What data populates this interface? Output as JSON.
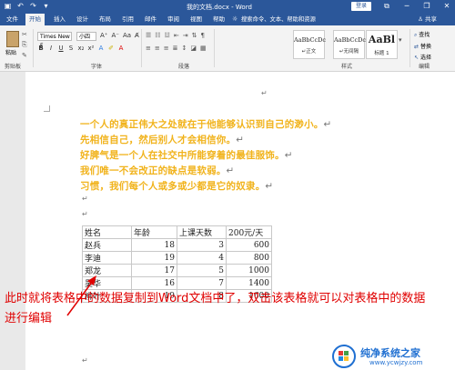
{
  "titlebar": {
    "doc_title": "我的文档.docx - Word",
    "login": "登录",
    "minimize": "─",
    "restore": "❐",
    "close": "✕"
  },
  "tabs": [
    "文件",
    "开始",
    "插入",
    "设计",
    "布局",
    "引用",
    "邮件",
    "审阅",
    "视图",
    "帮助"
  ],
  "active_tab": "开始",
  "tell_me": "搜索命令、文本、帮助和资源",
  "share": "共享",
  "ribbon": {
    "paste": "粘贴",
    "font_name": "Times New F",
    "font_size": "小四",
    "groups": {
      "clipboard": "剪贴板",
      "font": "字体",
      "paragraph": "段落",
      "styles": "样式",
      "edit": "编辑"
    },
    "styles": [
      {
        "sample": "AaBbCcDc",
        "name": "↵正文"
      },
      {
        "sample": "AaBbCcDc",
        "name": "↵无间隔"
      },
      {
        "sample": "AaBl",
        "name": "标题 1"
      }
    ],
    "edit_items": [
      "查找",
      "替换",
      "选择"
    ]
  },
  "document": {
    "lines": [
      "一个人的真正伟大之处就在于他能够认识到自己的渺小。",
      "先相信自己，然后别人才会相信你。",
      "好脾气是一个人在社交中所能穿着的最佳服饰。",
      "我们唯一不会改正的缺点是软弱。",
      "习惯，我们每个人或多或少都是它的奴隶。"
    ],
    "para_mark": "↵",
    "text_color": "#f1b31c",
    "table": {
      "headers": [
        "姓名",
        "年龄",
        "上课天数",
        "200元/天"
      ],
      "rows": [
        [
          "赵兵",
          "18",
          "3",
          "600"
        ],
        [
          "李迪",
          "19",
          "4",
          "800"
        ],
        [
          "郑龙",
          "17",
          "5",
          "1000"
        ],
        [
          "吴华",
          "16",
          "7",
          "1400"
        ],
        [
          "柳叶",
          "19",
          "8",
          "1600"
        ]
      ]
    }
  },
  "annotation": {
    "text": "此时就将表格中的数据复制到Word文档中了，双击该表格就可以对表格中的数据进行编辑",
    "color": "#e00000"
  },
  "watermark": {
    "name": "纯净系统之家",
    "url": "www.ycwjzy.com"
  }
}
